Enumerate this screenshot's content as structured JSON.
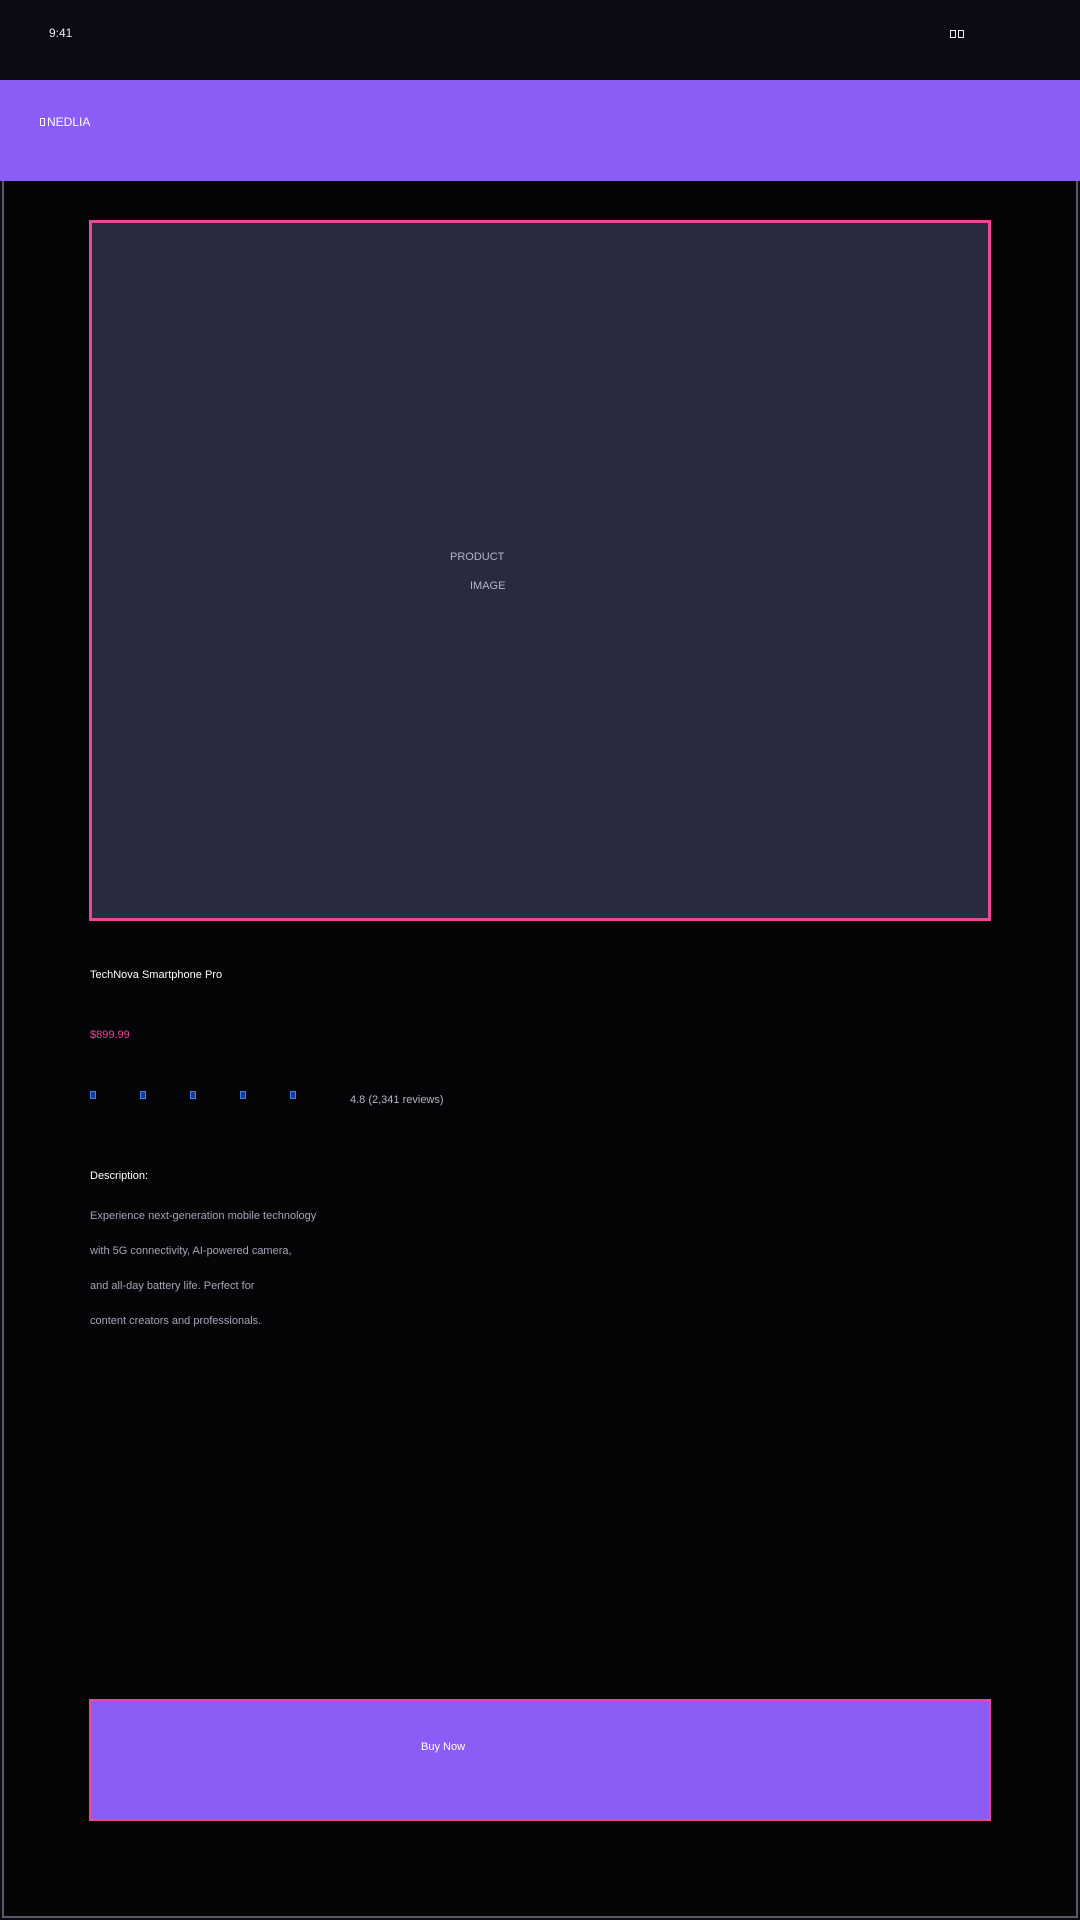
{
  "status_bar": {
    "time": "9:41",
    "icons": [
      "signal-icon",
      "battery-icon"
    ]
  },
  "header": {
    "brand_icon": "logo-icon",
    "brand_name": "NEDLIA"
  },
  "product": {
    "image_placeholder_line1": "PRODUCT",
    "image_placeholder_line2": "IMAGE",
    "title": "TechNova Smartphone Pro",
    "price": "$899.99",
    "rating": {
      "stars": 5,
      "text": "4.8 (2,341 reviews)"
    },
    "description_heading": "Description:",
    "description_lines": [
      "Experience next-generation mobile technology",
      "with 5G connectivity, AI-powered camera,",
      "and all-day battery life. Perfect for",
      "content creators and professionals."
    ]
  },
  "actions": {
    "buy_label": "Buy Now"
  },
  "colors": {
    "background": "#0b0b14",
    "accent": "#8b5cf6",
    "highlight": "#ec4899",
    "star": "#3b82f6",
    "image_panel": "#282a3d"
  }
}
